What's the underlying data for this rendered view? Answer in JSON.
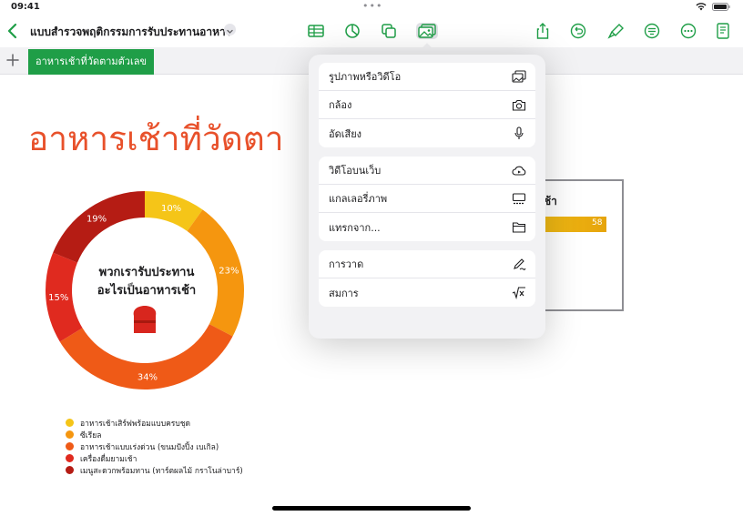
{
  "status": {
    "time": "09:41",
    "dots": "•••"
  },
  "toolbar": {
    "doc_title": "แบบสำรวจพฤติกรรมการรับประทานอาหาร",
    "icons": [
      "back-icon",
      "table-icon",
      "chart-icon",
      "shapes-icon",
      "media-icon",
      "share-icon",
      "undo-icon",
      "brush-icon",
      "format-icon",
      "more-icon",
      "document-icon"
    ]
  },
  "sheets": {
    "tabs": [
      {
        "label": "อาหารเช้าที่วัดตามตัวเลข"
      }
    ]
  },
  "canvas": {
    "title": "อาหารเช้าที่วัดตา"
  },
  "chart_data": [
    {
      "type": "pie",
      "title": "พวกเรารับประทานอะไรเป็นอาหารเช้า",
      "categories": [
        "อาหารเช้าเสิร์ฟพร้อมแบบครบชุด",
        "ซีเรียล",
        "อาหารเช้าแบบเร่งด่วน (ขนมปังปิ้ง เบเกิล)",
        "เครื่องดื่มยามเช้า",
        "เมนูสะดวกพร้อมทาน (ทาร์ตผลไม้ กราโนล่าบาร์)"
      ],
      "values": [
        10,
        23,
        34,
        15,
        19
      ],
      "labels": [
        "10%",
        "23%",
        "34%",
        "15%",
        "19%"
      ],
      "colors": [
        "#f5c518",
        "#f5960f",
        "#ef5a17",
        "#e02a1f",
        "#b51c14"
      ],
      "legend": "bottom-left"
    },
    {
      "type": "bar",
      "title": "ช้า",
      "values": [
        58
      ],
      "labels": [
        "58"
      ]
    }
  ],
  "chart_labels": {
    "center_line1": "พวกเรารับประทาน",
    "center_line2": "อะไรเป็นอาหารเช้า"
  },
  "popover": {
    "groups": [
      {
        "items": [
          {
            "label": "รูปภาพหรือวิดีโอ",
            "icon": "photo-icon"
          },
          {
            "label": "กล้อง",
            "icon": "camera-icon"
          },
          {
            "label": "อัดเสียง",
            "icon": "microphone-icon"
          }
        ]
      },
      {
        "items": [
          {
            "label": "วิดีโอบนเว็บ",
            "icon": "cloud-play-icon"
          },
          {
            "label": "แกลเลอรี่ภาพ",
            "icon": "gallery-icon"
          },
          {
            "label": "แทรกจาก...",
            "icon": "folder-icon"
          }
        ]
      },
      {
        "items": [
          {
            "label": "การวาด",
            "icon": "pen-icon"
          },
          {
            "label": "สมการ",
            "icon": "equation-icon"
          }
        ]
      }
    ]
  }
}
